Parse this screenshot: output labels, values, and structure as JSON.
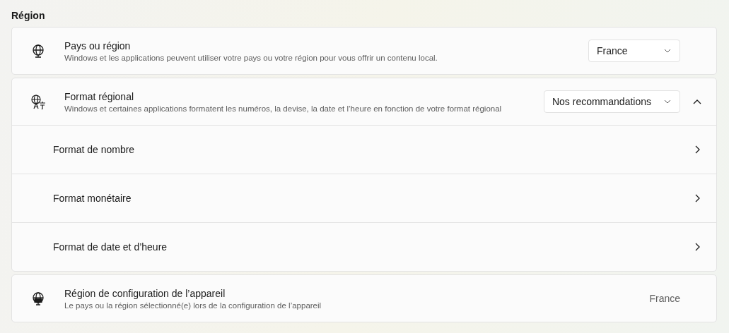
{
  "section_title": "Région",
  "cards": [
    {
      "kind": "dropdown",
      "title": "Pays ou région",
      "description": "Windows et les applications peuvent utiliser votre pays ou votre région pour vous offrir un contenu local.",
      "value": "France"
    },
    {
      "kind": "expander",
      "title": "Format régional",
      "description": "Windows et certaines applications formatent les numéros, la devise, la date et l’heure en fonction de votre format régional",
      "value": "Nos recommandations",
      "expanded": true,
      "children": [
        {
          "label": "Format de nombre"
        },
        {
          "label": "Format monétaire"
        },
        {
          "label": "Format de date et d’heure"
        }
      ]
    },
    {
      "kind": "readonly",
      "title": "Région de configuration de l’appareil",
      "description": "Le pays ou la région sélectionné(e) lors de la configuration de l’appareil",
      "value": "France"
    }
  ]
}
